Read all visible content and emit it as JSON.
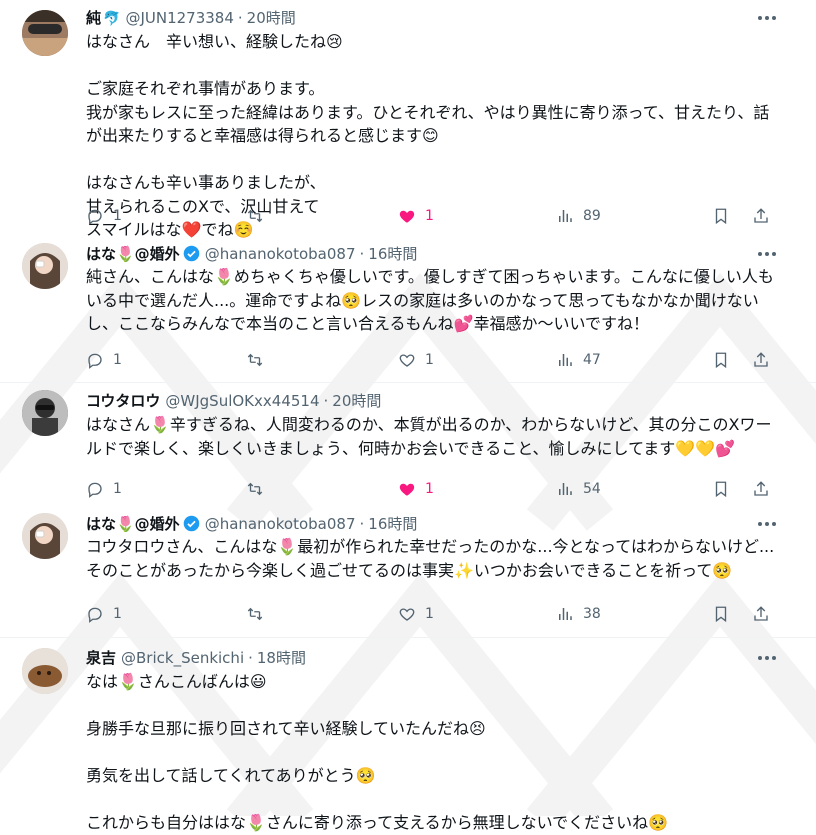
{
  "tweets": [
    {
      "name": "純",
      "name_emoji": "🐬",
      "handle": "@JUN1273384",
      "time": "20時間",
      "paragraphs": [
        "はなさん　辛い想い、経験したね😢",
        "ご家庭それぞれ事情があります。\n我が家もレスに至った経緯はあります。ひとそれぞれ、やはり異性に寄り添って、甘えたり、話が出来たりすると幸福感は得られると感じます😊",
        "はなさんも辛い事ありましたが、\n甘えられるこのXで、沢山甘えて\nスマイルはな❤️でね☺️"
      ],
      "reply_count": "1",
      "retweet_count": "",
      "like_count": "1",
      "liked": true,
      "view_count": "89"
    },
    {
      "name": "はな🌷@婚外",
      "verified": true,
      "handle": "@hananokotoba087",
      "time": "16時間",
      "paragraphs": [
        "純さん、こんはな🌷めちゃくちゃ優しいです。優しすぎて困っちゃいます。こんなに優しい人もいる中で選んだ人...。運命ですよね🥺レスの家庭は多いのかなって思ってもなかなか聞けないし、ここならみんなで本当のこと言い合えるもんね💕幸福感か〜いいですね！"
      ],
      "reply_count": "1",
      "retweet_count": "",
      "like_count": "1",
      "liked": false,
      "view_count": "47"
    },
    {
      "name": "コウタロウ",
      "handle": "@WJgSulOKxx44514",
      "time": "20時間",
      "paragraphs": [
        "はなさん🌷辛すぎるね、人間変わるのか、本質が出るのか、わからないけど、其の分このXワールドで楽しく、楽しくいきましょう、何時かお会いできること、愉しみにしてます💛💛💕"
      ],
      "reply_count": "1",
      "retweet_count": "",
      "like_count": "1",
      "liked": true,
      "view_count": "54"
    },
    {
      "name": "はな🌷@婚外",
      "verified": true,
      "handle": "@hananokotoba087",
      "time": "16時間",
      "paragraphs": [
        "コウタロウさん、こんはな🌷最初が作られた幸せだったのかな...今となってはわからないけど...そのことがあったから今楽しく過ごせてるのは事実✨いつかお会いできることを祈って🥺"
      ],
      "reply_count": "1",
      "retweet_count": "",
      "like_count": "1",
      "liked": false,
      "view_count": "38"
    },
    {
      "name": "泉吉",
      "handle": "@Brick_Senkichi",
      "time": "18時間",
      "paragraphs": [
        "なは🌷さんこんばんは😃",
        "身勝手な旦那に振り回されて辛い経験していたんだね😣",
        "勇気を出して話してくれてありがとう🥺",
        "これからも自分ははな🌷さんに寄り添って支えるから無理しないでくださいね🥺"
      ]
    }
  ],
  "colors": {
    "like": "#f91880",
    "verified": "#1d9bf0",
    "secondary": "#536471"
  }
}
